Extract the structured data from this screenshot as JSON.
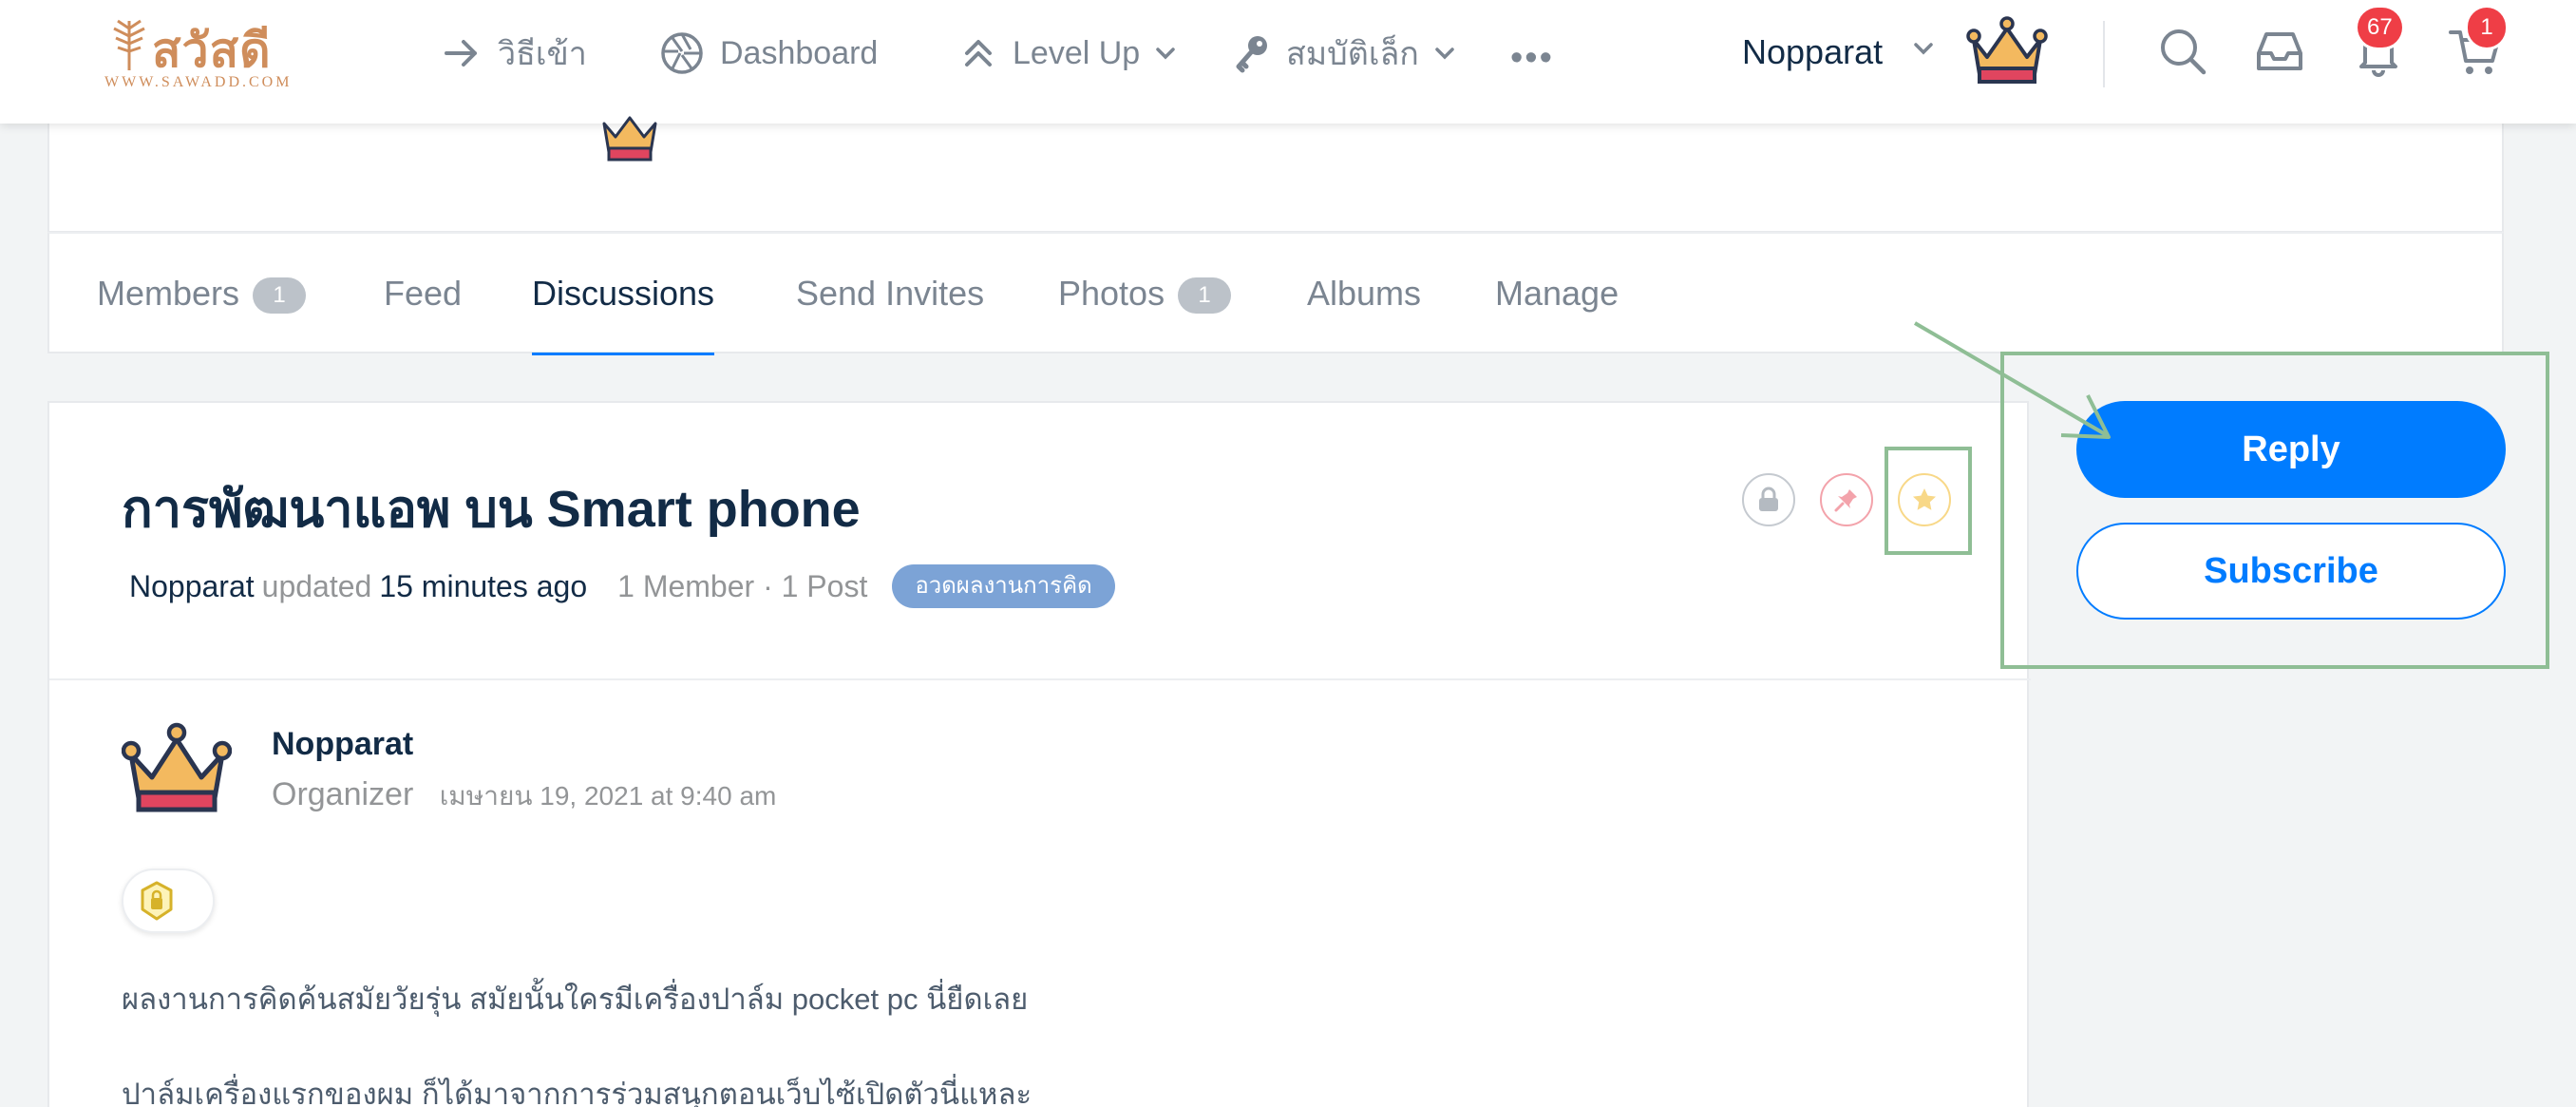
{
  "header": {
    "logo_text": "สวัสดี",
    "logo_subtext": "WWW.SAWADD.COM",
    "nav": [
      {
        "label": "วิธีเข้า",
        "icon": "arrow-right-icon"
      },
      {
        "label": "Dashboard",
        "icon": "aperture-icon"
      },
      {
        "label": "Level Up",
        "icon": "chevrons-up-icon"
      },
      {
        "label": "สมบัติเล็ก",
        "icon": "key-icon"
      }
    ],
    "more_label": "•••",
    "user_name": "Nopparat",
    "notifications_count": "67",
    "cart_count": "1"
  },
  "tabs": [
    {
      "label": "Members",
      "count": "1"
    },
    {
      "label": "Feed"
    },
    {
      "label": "Discussions"
    },
    {
      "label": "Send Invites"
    },
    {
      "label": "Photos",
      "count": "1"
    },
    {
      "label": "Albums"
    },
    {
      "label": "Manage"
    }
  ],
  "discussion": {
    "title": "การพัฒนาแอพ บน Smart phone",
    "author": "Nopparat",
    "updated_word": "updated",
    "updated_time": "15 minutes ago",
    "stats": "1 Member · 1 Post",
    "category": "อวดผลงานการคิด"
  },
  "post": {
    "author": "Nopparat",
    "role": "Organizer",
    "date": "เมษายน 19, 2021 at 9:40 am",
    "paragraphs": [
      "ผลงานการคิดค้นสมัยวัยรุ่น สมัยนั้นใครมีเครื่องปาล์ม pocket pc นี่ยืดเลย",
      "ปาล์มเครื่องแรกของผม ก็ได้มาจากการร่วมสนุกตอนเว็บไซ้เปิดตัวนี่แหละ"
    ]
  },
  "actions": {
    "reply_label": "Reply",
    "subscribe_label": "Subscribe"
  },
  "colors": {
    "primary": "#007cff",
    "annotation": "#8fbe95",
    "badge": "#ef3e46",
    "category_tag": "#7ca3d6",
    "logo": "#cf8d5b"
  }
}
